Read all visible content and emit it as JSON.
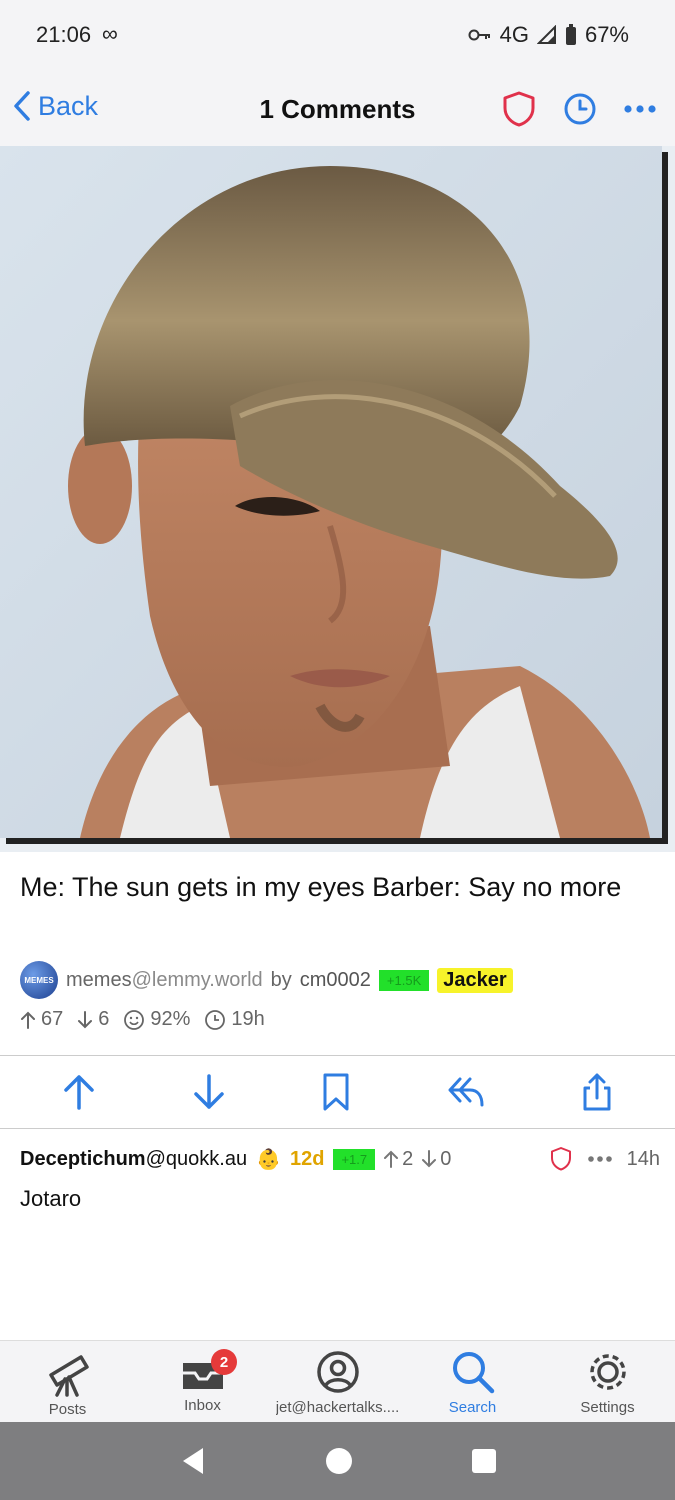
{
  "status_bar": {
    "time": "21:06",
    "network": "4G",
    "battery": "67%"
  },
  "nav": {
    "back_label": "Back",
    "title": "1 Comments"
  },
  "post": {
    "title": "Me: The sun gets in my eyes Barber: Say no more",
    "community_name": "memes",
    "community_instance": "@lemmy.world",
    "by_label": "by",
    "author": "cm0002",
    "author_badge_green": "+1.5K",
    "author_badge_yellow": "Jacker",
    "avatar_text": "MEMES",
    "upvotes": "67",
    "downvotes": "6",
    "upvote_ratio": "92%",
    "age": "19h"
  },
  "comment": {
    "author": "Deceptichum",
    "instance": "@quokk.au",
    "account_age": "12d",
    "green_badge": "+1.7",
    "upvotes": "2",
    "downvotes": "0",
    "time": "14h",
    "body": "Jotaro"
  },
  "tabs": [
    {
      "label": "Posts"
    },
    {
      "label": "Inbox",
      "badge": "2"
    },
    {
      "label": "jet@hackertalks...."
    },
    {
      "label": "Search"
    },
    {
      "label": "Settings"
    }
  ],
  "colors": {
    "accent": "#2f7de1",
    "shield": "#e0314b",
    "badge_red": "#e53a3a"
  }
}
